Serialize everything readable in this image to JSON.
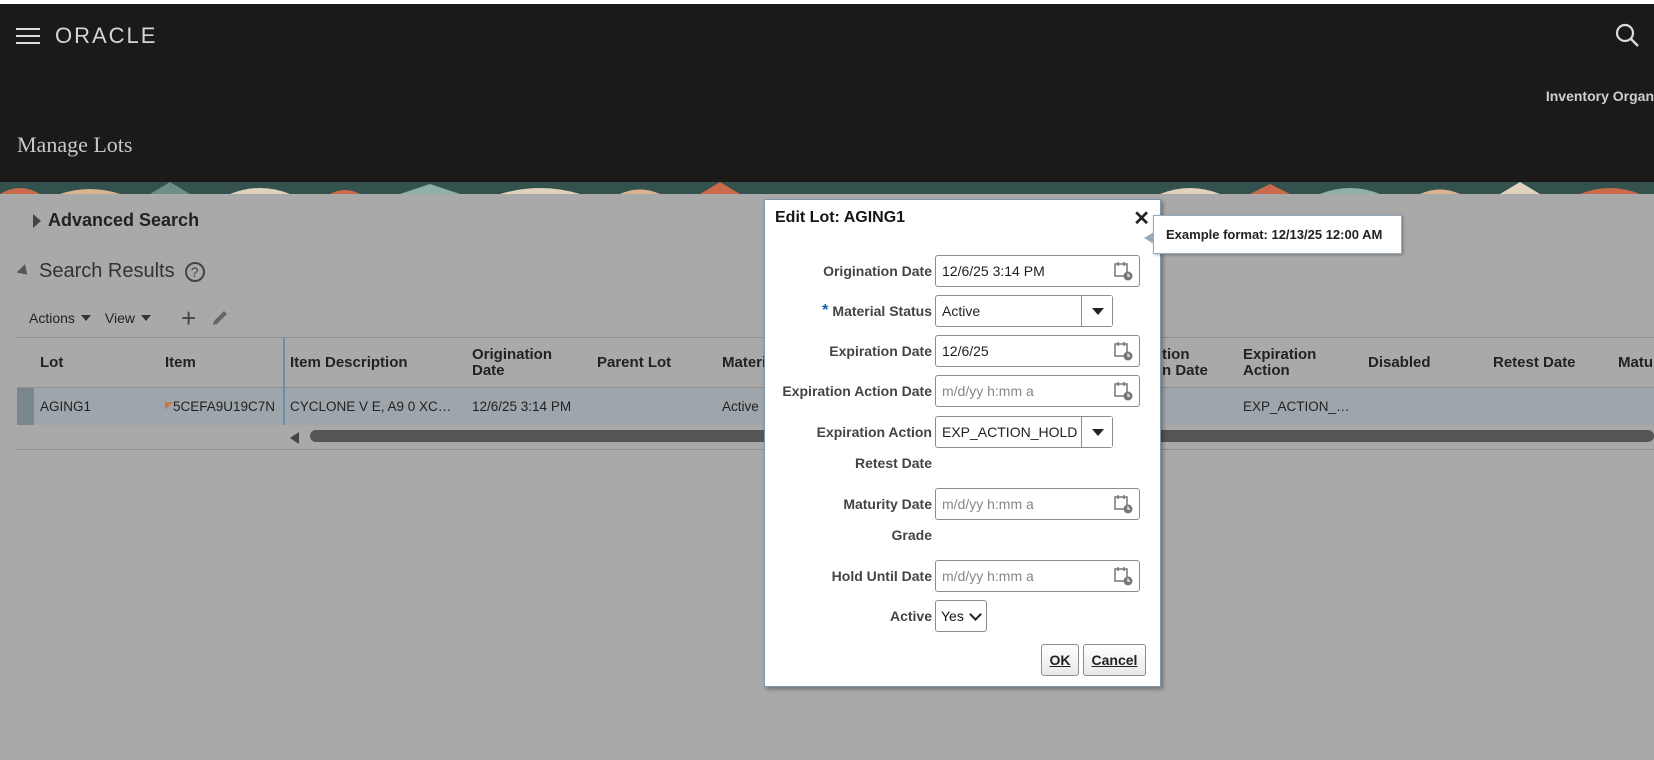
{
  "header": {
    "logo": "ORACLE",
    "org_label": "Inventory Organ",
    "page_title": "Manage Lots"
  },
  "advanced_search": {
    "label": "Advanced Search"
  },
  "search_results": {
    "label": "Search Results",
    "help": "?",
    "toolbar": {
      "actions": "Actions",
      "view": "View"
    },
    "columns": [
      "Lot",
      "Item",
      "Item Description",
      "Origination Date",
      "Parent Lot",
      "Materi",
      "tion\nn Date",
      "Expiration Action",
      "Disabled",
      "Retest Date",
      "Matur"
    ],
    "row": {
      "lot": "AGING1",
      "item": "5CEFA9U19C7N",
      "item_description": "CYCLONE V E, A9 0 XC…",
      "origination_date": "12/6/25 3:14 PM",
      "parent_lot": "",
      "material_status": "Active",
      "expiration_action": "EXP_ACTION_…"
    }
  },
  "dialog": {
    "title": "Edit Lot: AGING1",
    "close": "✕",
    "fields": {
      "origination_date": {
        "label": "Origination Date",
        "value": "12/6/25 3:14 PM"
      },
      "material_status": {
        "label": "Material Status",
        "required_mark": "*",
        "value": "Active"
      },
      "expiration_date": {
        "label": "Expiration Date",
        "value": "12/6/25"
      },
      "expiration_action_date": {
        "label": "Expiration Action Date",
        "placeholder": "m/d/yy h:mm a"
      },
      "expiration_action": {
        "label": "Expiration Action",
        "value": "EXP_ACTION_HOLD"
      },
      "retest_date": {
        "label": "Retest Date"
      },
      "maturity_date": {
        "label": "Maturity Date",
        "placeholder": "m/d/yy h:mm a"
      },
      "grade": {
        "label": "Grade"
      },
      "hold_until_date": {
        "label": "Hold Until Date",
        "placeholder": "m/d/yy h:mm a"
      },
      "active": {
        "label": "Active",
        "value": "Yes"
      }
    },
    "ok": "OK",
    "cancel": "Cancel"
  },
  "tooltip": {
    "text": "Example format: 12/13/25 12:00 AM"
  },
  "colors": {
    "header_bg": "#1c1a18",
    "overlay_bg": "#a9a9a9",
    "selected_row": "#9ea6ac",
    "accent": "#1a5fb4"
  }
}
